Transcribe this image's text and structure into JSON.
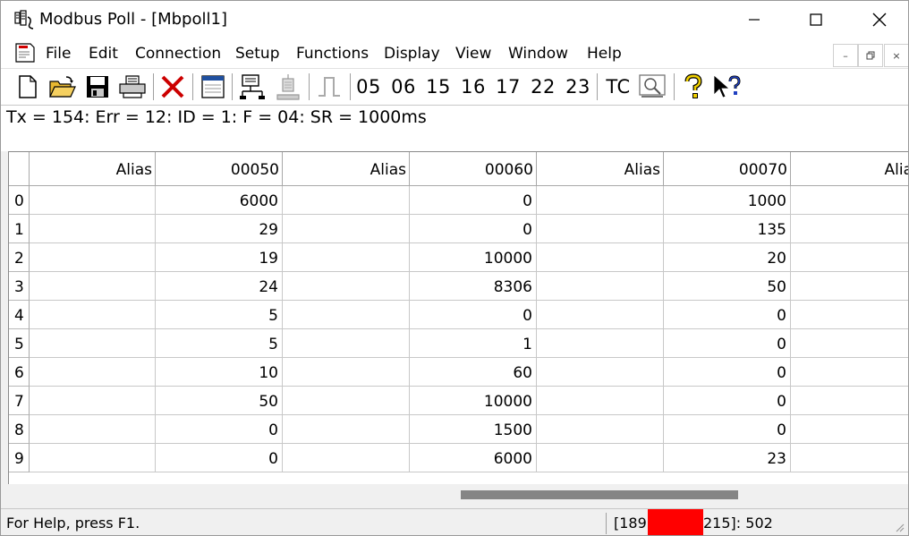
{
  "window": {
    "title": "Modbus Poll - [Mbpoll1]",
    "controls": {
      "minimize": "minimize-icon",
      "maximize": "maximize-icon",
      "close": "close-icon"
    }
  },
  "menu": {
    "items": [
      "File",
      "Edit",
      "Connection",
      "Setup",
      "Functions",
      "Display",
      "View",
      "Window",
      "Help"
    ],
    "mdi_controls": [
      "–",
      "🗗",
      "×"
    ]
  },
  "toolbar": {
    "function_codes": [
      "05",
      "06",
      "15",
      "16",
      "17",
      "22",
      "23"
    ],
    "tc_label": "TC"
  },
  "status_line": "Tx = 154: Err = 12: ID = 1: F = 04: SR = 1000ms",
  "grid": {
    "headers": [
      "Alias",
      "00050",
      "Alias",
      "00060",
      "Alias",
      "00070",
      "Alia"
    ],
    "rows": [
      {
        "index": "0",
        "cells": [
          "",
          "6000",
          "",
          "0",
          "",
          "1000",
          ""
        ]
      },
      {
        "index": "1",
        "cells": [
          "",
          "29",
          "",
          "0",
          "",
          "135",
          ""
        ]
      },
      {
        "index": "2",
        "cells": [
          "",
          "19",
          "",
          "10000",
          "",
          "20",
          ""
        ]
      },
      {
        "index": "3",
        "cells": [
          "",
          "24",
          "",
          "8306",
          "",
          "50",
          ""
        ]
      },
      {
        "index": "4",
        "cells": [
          "",
          "5",
          "",
          "0",
          "",
          "0",
          ""
        ]
      },
      {
        "index": "5",
        "cells": [
          "",
          "5",
          "",
          "1",
          "",
          "0",
          ""
        ]
      },
      {
        "index": "6",
        "cells": [
          "",
          "10",
          "",
          "60",
          "",
          "0",
          ""
        ]
      },
      {
        "index": "7",
        "cells": [
          "",
          "50",
          "",
          "10000",
          "",
          "0",
          ""
        ]
      },
      {
        "index": "8",
        "cells": [
          "",
          "0",
          "",
          "1500",
          "",
          "0",
          ""
        ]
      },
      {
        "index": "9",
        "cells": [
          "",
          "0",
          "",
          "6000",
          "",
          "23",
          ""
        ]
      }
    ]
  },
  "statusbar": {
    "help": "For Help, press F1.",
    "connection_prefix": "[189.",
    "connection_suffix": "215]: 502"
  },
  "colors": {
    "redaction": "#ff0000",
    "scroll_thumb": "#858585"
  }
}
